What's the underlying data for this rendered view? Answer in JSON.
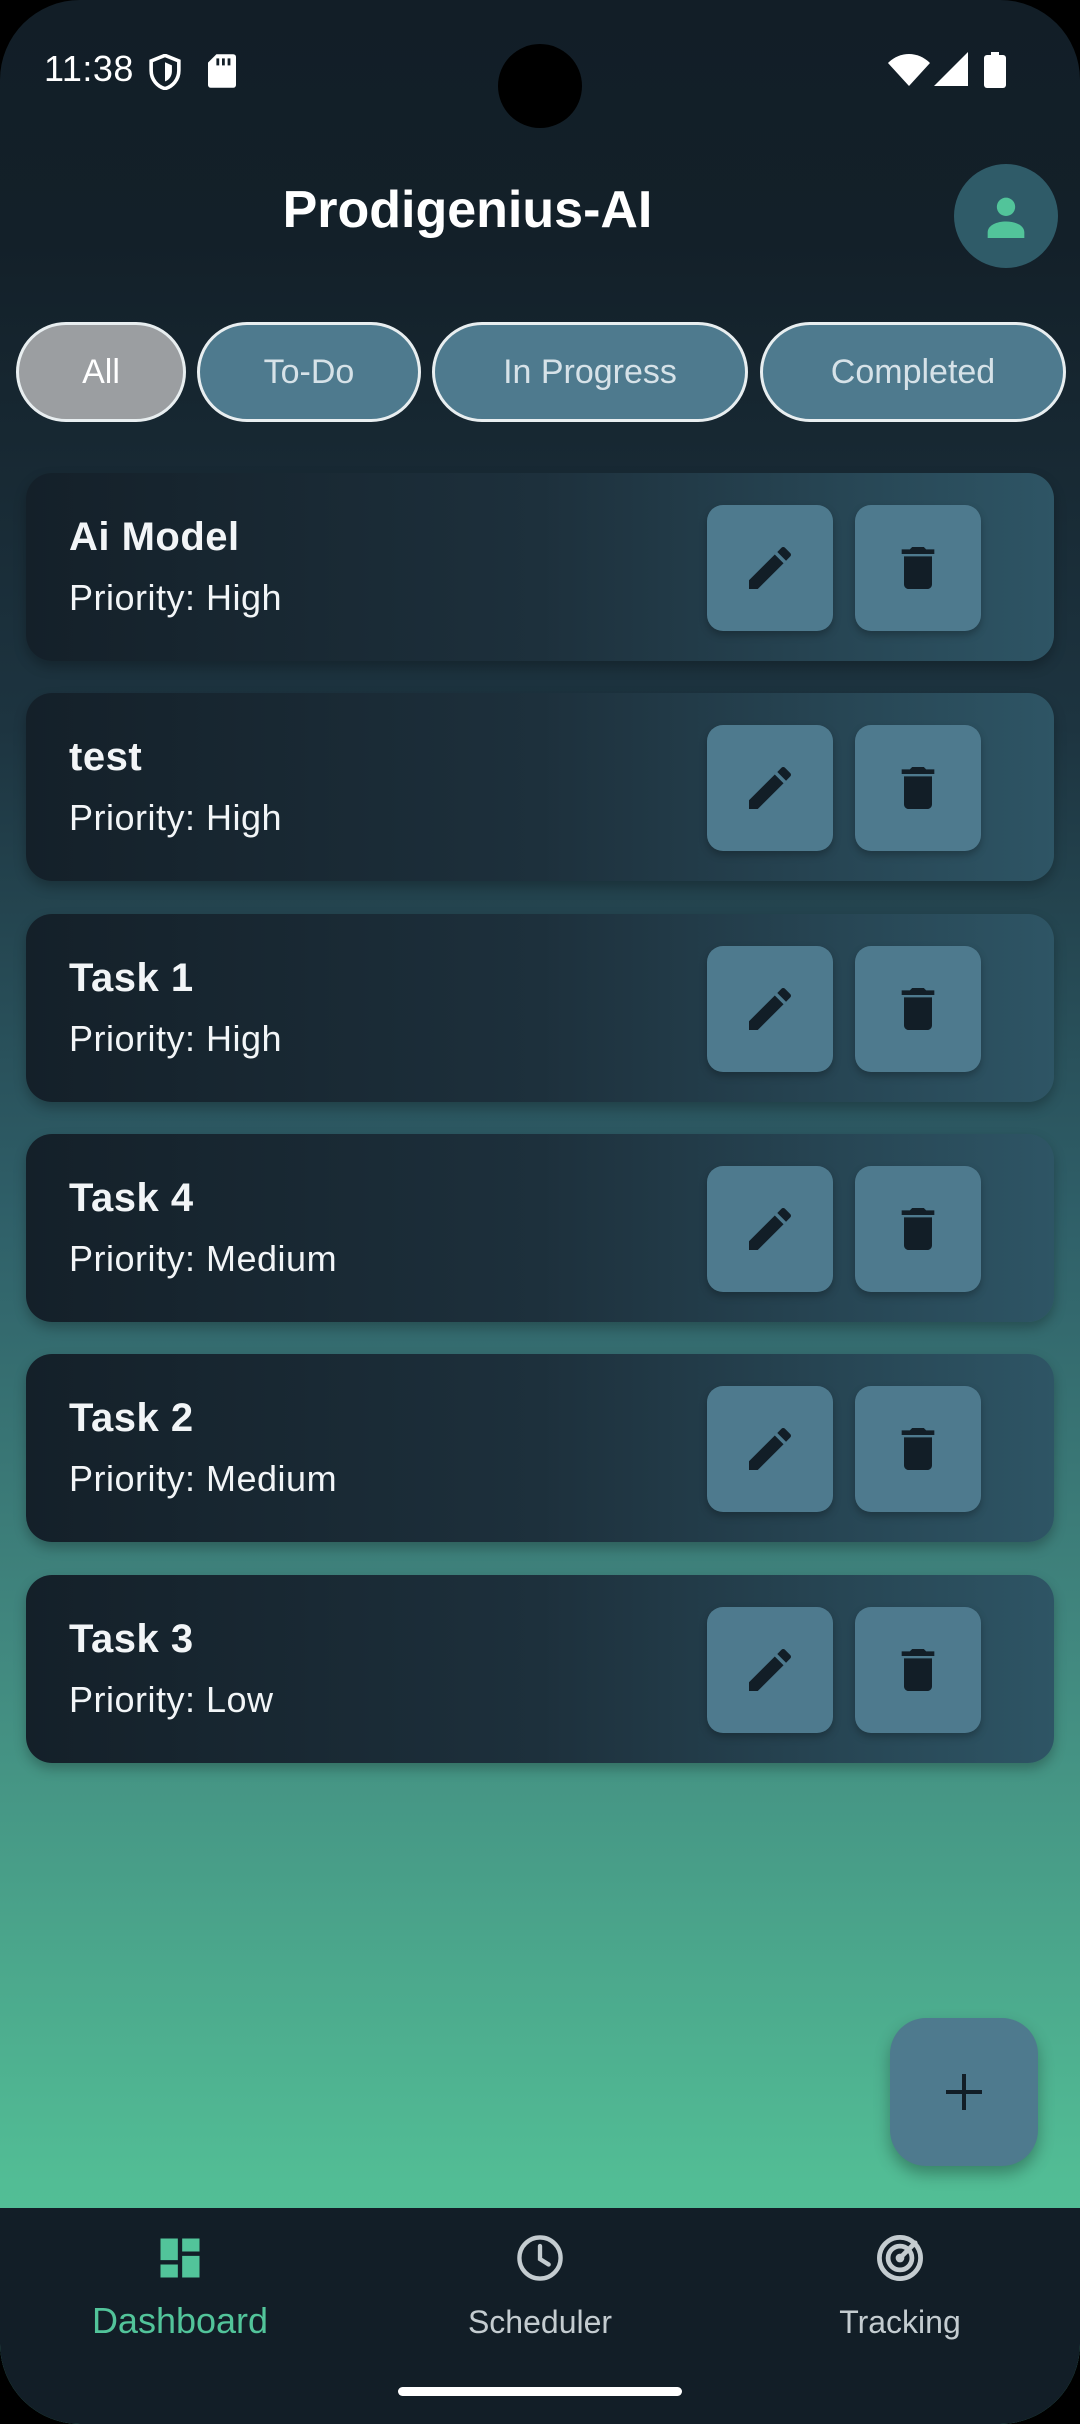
{
  "status_bar": {
    "time": "11:38"
  },
  "app_bar": {
    "title": "Prodigenius-AI",
    "profile_icon": "person-icon"
  },
  "filters": [
    {
      "label": "All",
      "active": true
    },
    {
      "label": "To-Do",
      "active": false
    },
    {
      "label": "In Progress",
      "active": false
    },
    {
      "label": "Completed",
      "active": false
    }
  ],
  "tasks": [
    {
      "title": "Ai Model",
      "priority": "Priority: High"
    },
    {
      "title": "test",
      "priority": "Priority: High"
    },
    {
      "title": "Task 1",
      "priority": "Priority: High"
    },
    {
      "title": "Task 4",
      "priority": "Priority: Medium"
    },
    {
      "title": "Task 2",
      "priority": "Priority: Medium"
    },
    {
      "title": "Task 3",
      "priority": "Priority: Low"
    }
  ],
  "task_actions": {
    "edit_icon": "pencil-icon",
    "delete_icon": "trash-icon"
  },
  "fab": {
    "icon": "plus-icon"
  },
  "bottom_nav": [
    {
      "label": "Dashboard",
      "icon": "dashboard-icon",
      "active": true
    },
    {
      "label": "Scheduler",
      "icon": "clock-icon",
      "active": false
    },
    {
      "label": "Tracking",
      "icon": "radar-icon",
      "active": false
    }
  ],
  "colors": {
    "accent": "#52c49a",
    "surface": "#4e7a8e",
    "background_top": "#121e27",
    "background_bottom": "#55c499"
  }
}
